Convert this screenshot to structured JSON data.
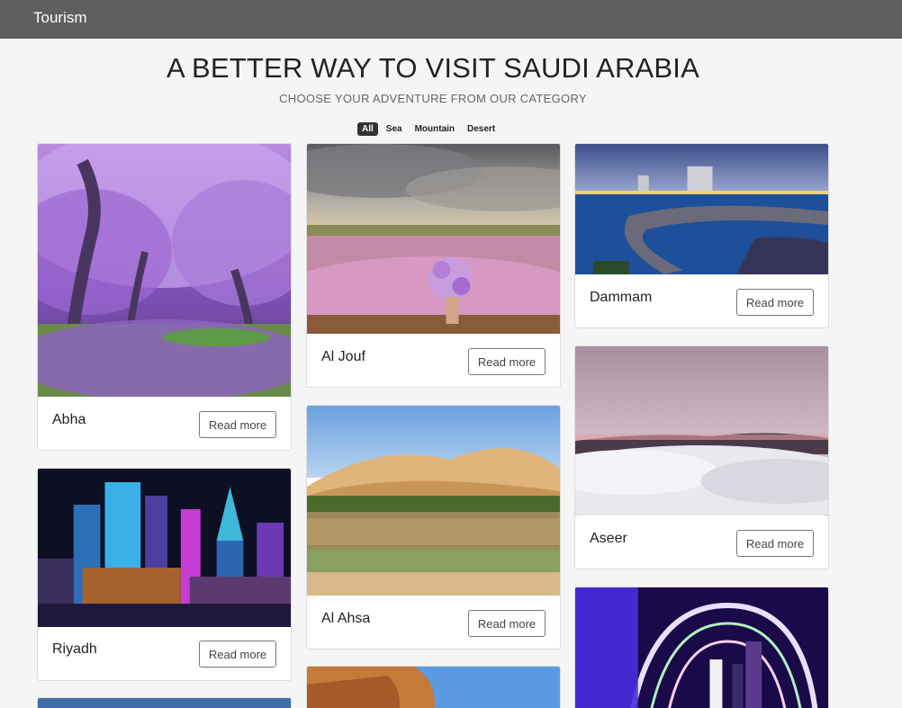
{
  "navbar": {
    "brand": "Tourism"
  },
  "hero": {
    "title": "A BETTER WAY TO VISIT SAUDI ARABIA",
    "subtitle": "CHOOSE YOUR ADVENTURE FROM OUR CATEGORY"
  },
  "filters": [
    {
      "label": "All",
      "active": true
    },
    {
      "label": "Sea",
      "active": false
    },
    {
      "label": "Mountain",
      "active": false
    },
    {
      "label": "Desert",
      "active": false
    }
  ],
  "cards": [
    {
      "name": "Abha",
      "button": "Read more"
    },
    {
      "name": "Riyadh",
      "button": "Read more"
    },
    {
      "name": "Al Jouf",
      "button": "Read more"
    },
    {
      "name": "Al Ahsa",
      "button": "Read more"
    },
    {
      "name": "Dammam",
      "button": "Read more"
    },
    {
      "name": "Aseer",
      "button": "Read more"
    }
  ]
}
